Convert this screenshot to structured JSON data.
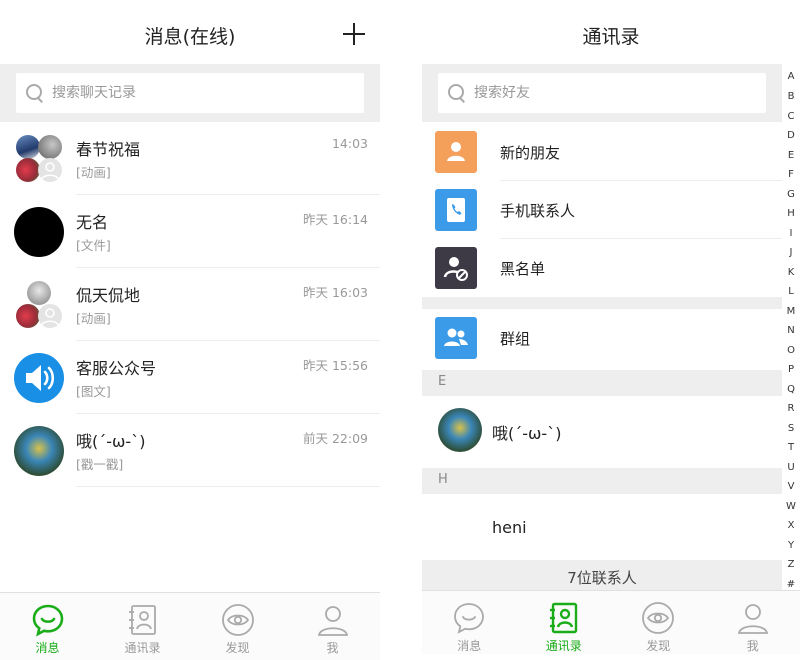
{
  "chats_screen": {
    "title": "消息(在线)",
    "search_placeholder": "搜索聊天记录",
    "conversations": [
      {
        "name": "春节祝福",
        "preview": "[动画]",
        "time": "14:03"
      },
      {
        "name": "无名",
        "preview": "[文件]",
        "time": "昨天 16:14"
      },
      {
        "name": "侃天侃地",
        "preview": "[动画]",
        "time": "昨天 16:03"
      },
      {
        "name": "客服公众号",
        "preview": "[图文]",
        "time": "昨天 15:56"
      },
      {
        "name": "哦(´-ω-`)",
        "preview": "[戳一戳]",
        "time": "前天 22:09"
      }
    ],
    "tabs": [
      {
        "label": "消息",
        "icon": "chat-bubble-icon",
        "active": true
      },
      {
        "label": "通讯录",
        "icon": "contacts-book-icon",
        "active": false
      },
      {
        "label": "发现",
        "icon": "eye-icon",
        "active": false
      },
      {
        "label": "我",
        "icon": "person-icon",
        "active": false
      }
    ]
  },
  "contacts_screen": {
    "title": "通讯录",
    "search_placeholder": "搜索好友",
    "entries": [
      {
        "label": "新的朋友",
        "icon": "new-friend-icon",
        "color": "#f5a05a"
      },
      {
        "label": "手机联系人",
        "icon": "phone-book-icon",
        "color": "#3b9be8"
      },
      {
        "label": "黑名单",
        "icon": "blocked-user-icon",
        "color": "#3d3945"
      }
    ],
    "group": {
      "label": "群组",
      "icon": "group-icon",
      "color": "#3b9be8"
    },
    "sections": [
      {
        "letter": "E",
        "contacts": [
          "哦(´-ω-`)"
        ]
      },
      {
        "letter": "H",
        "contacts": [
          "heni"
        ]
      }
    ],
    "footer": "7位联系人",
    "alphabet": [
      "A",
      "B",
      "C",
      "D",
      "E",
      "F",
      "G",
      "H",
      "I",
      "J",
      "K",
      "L",
      "M",
      "N",
      "O",
      "P",
      "Q",
      "R",
      "S",
      "T",
      "U",
      "V",
      "W",
      "X",
      "Y",
      "Z",
      "#"
    ],
    "tabs": [
      {
        "label": "消息",
        "icon": "chat-bubble-icon",
        "active": false
      },
      {
        "label": "通讯录",
        "icon": "contacts-book-icon",
        "active": true
      },
      {
        "label": "发现",
        "icon": "eye-icon",
        "active": false
      },
      {
        "label": "我",
        "icon": "person-icon",
        "active": false
      }
    ]
  },
  "colors": {
    "accent_green": "#1aad19",
    "inactive_gray": "#999999",
    "section_bg": "#eeeeee"
  }
}
